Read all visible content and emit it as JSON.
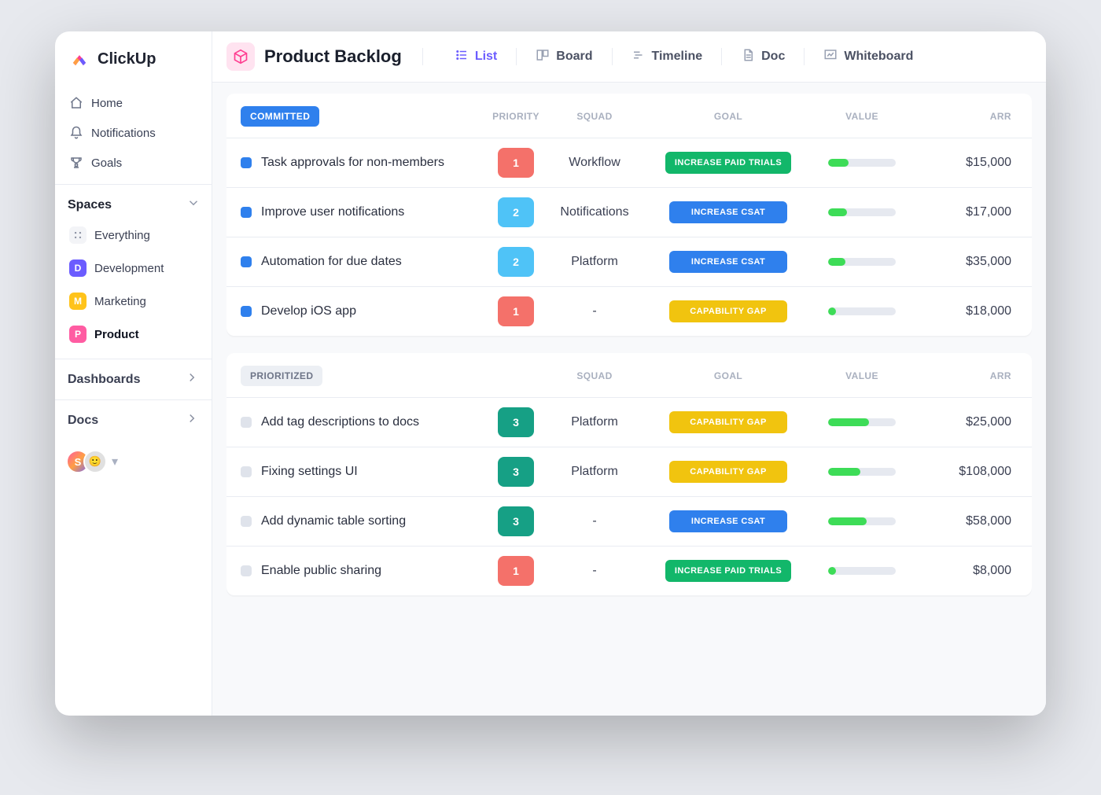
{
  "brand": {
    "name": "ClickUp"
  },
  "sidebar": {
    "nav": [
      {
        "icon": "home",
        "label": "Home"
      },
      {
        "icon": "bell",
        "label": "Notifications"
      },
      {
        "icon": "trophy",
        "label": "Goals"
      }
    ],
    "spaces_title": "Spaces",
    "spaces": [
      {
        "icon": "grid",
        "label": "Everything",
        "cls": "every"
      },
      {
        "icon": "D",
        "label": "Development",
        "cls": "dev"
      },
      {
        "icon": "M",
        "label": "Marketing",
        "cls": "mkt"
      },
      {
        "icon": "P",
        "label": "Product",
        "cls": "prod",
        "active": true
      }
    ],
    "dashboards": "Dashboards",
    "docs": "Docs",
    "avatars": [
      "S",
      ""
    ]
  },
  "header": {
    "title": "Product Backlog",
    "views": [
      {
        "icon": "list",
        "label": "List",
        "active": true
      },
      {
        "icon": "board",
        "label": "Board"
      },
      {
        "icon": "timeline",
        "label": "Timeline"
      },
      {
        "icon": "doc",
        "label": "Doc"
      },
      {
        "icon": "whiteboard",
        "label": "Whiteboard"
      }
    ]
  },
  "columns": {
    "priority": "PRIORITY",
    "squad": "SQUAD",
    "goal": "GOAL",
    "value": "VALUE",
    "arr": "ARR"
  },
  "groups": [
    {
      "title": "COMMITTED",
      "pill": "blue",
      "show_priority": true,
      "rows": [
        {
          "dot": "blue",
          "task": "Task approvals for non-members",
          "priority": {
            "val": "1",
            "cls": "red"
          },
          "squad": "Workflow",
          "goal": {
            "text": "INCREASE PAID TRIALS",
            "cls": "green"
          },
          "value": 30,
          "arr": "$15,000"
        },
        {
          "dot": "blue",
          "task": "Improve  user notifications",
          "priority": {
            "val": "2",
            "cls": "sky"
          },
          "squad": "Notifications",
          "goal": {
            "text": "INCREASE CSAT",
            "cls": "blue"
          },
          "value": 28,
          "arr": "$17,000"
        },
        {
          "dot": "blue",
          "task": "Automation for due dates",
          "priority": {
            "val": "2",
            "cls": "sky"
          },
          "squad": "Platform",
          "goal": {
            "text": "INCREASE CSAT",
            "cls": "blue"
          },
          "value": 25,
          "arr": "$35,000"
        },
        {
          "dot": "blue",
          "task": "Develop iOS app",
          "priority": {
            "val": "1",
            "cls": "red"
          },
          "squad": "-",
          "goal": {
            "text": "CAPABILITY GAP",
            "cls": "yellow"
          },
          "value": 12,
          "arr": "$18,000"
        }
      ]
    },
    {
      "title": "PRIORITIZED",
      "pill": "gray",
      "show_priority": false,
      "rows": [
        {
          "dot": "gray",
          "task": "Add tag descriptions to docs",
          "priority": {
            "val": "3",
            "cls": "grn"
          },
          "squad": "Platform",
          "goal": {
            "text": "CAPABILITY GAP",
            "cls": "yellow"
          },
          "value": 60,
          "arr": "$25,000"
        },
        {
          "dot": "gray",
          "task": "Fixing settings UI",
          "priority": {
            "val": "3",
            "cls": "grn"
          },
          "squad": "Platform",
          "goal": {
            "text": "CAPABILITY GAP",
            "cls": "yellow"
          },
          "value": 48,
          "arr": "$108,000"
        },
        {
          "dot": "gray",
          "task": "Add dynamic table sorting",
          "priority": {
            "val": "3",
            "cls": "grn"
          },
          "squad": "-",
          "goal": {
            "text": "INCREASE CSAT",
            "cls": "blue"
          },
          "value": 57,
          "arr": "$58,000"
        },
        {
          "dot": "gray",
          "task": "Enable public sharing",
          "priority": {
            "val": "1",
            "cls": "red"
          },
          "squad": "-",
          "goal": {
            "text": "INCREASE PAID TRIALS",
            "cls": "green"
          },
          "value": 12,
          "arr": "$8,000"
        }
      ]
    }
  ]
}
